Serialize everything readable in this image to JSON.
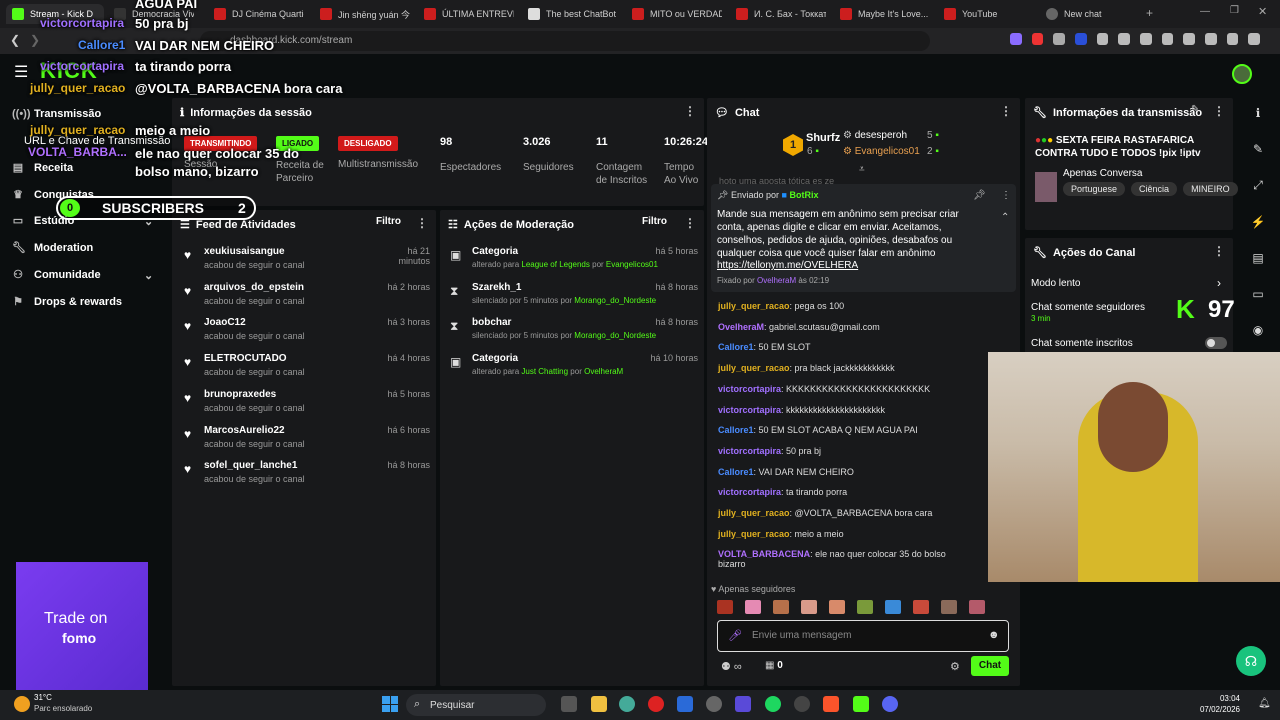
{
  "browser": {
    "tabs": [
      {
        "label": "Stream - Kick D",
        "active": true
      },
      {
        "label": "Democracia Viva"
      },
      {
        "label": "DJ Cinéma Quartier"
      },
      {
        "label": "Jin shēng yuán 今生"
      },
      {
        "label": "ÚLTIMA ENTREVIST"
      },
      {
        "label": "The best ChatBot ar"
      },
      {
        "label": "MITO ou VERDADE"
      },
      {
        "label": "И. С. Бах - Токката"
      },
      {
        "label": "Maybe It's Love..."
      },
      {
        "label": "YouTube"
      },
      {
        "label": "New chat"
      }
    ],
    "url": "dashboard.kick.com/stream"
  },
  "overlay": {
    "lines": [
      {
        "user": "victorcortapira",
        "user_color": "#a070ff",
        "msg": "50 pra bj"
      },
      {
        "user": "Callore1",
        "user_color": "#4a8cff",
        "msg": "VAI DAR NEM CHEIRO"
      },
      {
        "user": "victorcortapira",
        "user_color": "#a070ff",
        "msg": "ta tirando porra"
      },
      {
        "user": "jully_quer_racao",
        "user_color": "#e0b020",
        "msg": "@VOLTA_BARBACENA bora cara"
      },
      {
        "user": "jully_quer_racao",
        "user_color": "#e0b020",
        "msg": "meio a meio"
      },
      {
        "user": "VOLTA_BARBA...",
        "user_color": "#b070ff",
        "msg": "ele nao quer colocar 35 do bolso mano, bizarro"
      }
    ],
    "top_text": "AGUA PAI",
    "subscribers_label": "SUBSCRIBERS",
    "subscribers_left": "0",
    "subscribers_right": "2",
    "kick_count": "97",
    "ad_line1": "Trade on",
    "ad_line2": "fomo"
  },
  "sidebar": {
    "brand": "KICK",
    "items": [
      {
        "label": "Transmissão"
      },
      {
        "label": "URL e Chave de Transmissão"
      },
      {
        "label": "Receita"
      },
      {
        "label": "Conquistas"
      },
      {
        "label": "Estúdio"
      },
      {
        "label": "Moderation"
      },
      {
        "label": "Comunidade"
      },
      {
        "label": "Drops & rewards"
      }
    ]
  },
  "session": {
    "title": "Informações da sessão",
    "badges": [
      {
        "text": "TRANSMITINDO",
        "label": "Sessão",
        "color": "#d11a1a"
      },
      {
        "text": "LIGADO",
        "label": "Receita de Parceiro",
        "color": "#53fc18"
      },
      {
        "text": "DESLIGADO",
        "label": "Multistransmissão",
        "color": "#d11a1a"
      }
    ],
    "stats": [
      {
        "value": "98",
        "label": "Espectadores"
      },
      {
        "value": "3.026",
        "label": "Seguidores"
      },
      {
        "value": "11",
        "label": "Contagem de Inscritos"
      },
      {
        "value": "10:26:24",
        "label": "Tempo Ao Vivo"
      }
    ]
  },
  "activity": {
    "title": "Feed de Atividades",
    "filter": "Filtro",
    "items": [
      {
        "name": "xeukiusaisangue",
        "sub": "acabou de seguir o canal",
        "time": "há 21 minutos"
      },
      {
        "name": "arquivos_do_epstein",
        "sub": "acabou de seguir o canal",
        "time": "há 2 horas"
      },
      {
        "name": "JoaoC12",
        "sub": "acabou de seguir o canal",
        "time": "há 3 horas"
      },
      {
        "name": "ELETROCUTADO",
        "sub": "acabou de seguir o canal",
        "time": "há 4 horas"
      },
      {
        "name": "brunopraxedes",
        "sub": "acabou de seguir o canal",
        "time": "há 5 horas"
      },
      {
        "name": "MarcosAurelio22",
        "sub": "acabou de seguir o canal",
        "time": "há 6 horas"
      },
      {
        "name": "sofel_quer_lanche1",
        "sub": "acabou de seguir o canal",
        "time": "há 8 horas"
      }
    ]
  },
  "moderation": {
    "title": "Ações de Moderação",
    "filter": "Filtro",
    "items": [
      {
        "icon": "category-icon",
        "name": "Categoria",
        "pre": "alterado para ",
        "target": "League of Legends",
        "by": " por ",
        "mod": "Evangelicos01",
        "time": "há 5 horas"
      },
      {
        "icon": "hourglass-icon",
        "name": "Szarekh_1",
        "pre": "silenciado por 5 minutos por ",
        "target": "",
        "by": "",
        "mod": "Morango_do_Nordeste",
        "time": "há 8 horas"
      },
      {
        "icon": "hourglass-icon",
        "name": "bobchar",
        "pre": "silenciado por 5 minutos por ",
        "target": "",
        "by": "",
        "mod": "Morango_do_Nordeste",
        "time": "há 8 horas"
      },
      {
        "icon": "category-icon",
        "name": "Categoria",
        "pre": "alterado para ",
        "target": "Just Chatting",
        "by": " por ",
        "mod": "OvelheraM",
        "time": "há 10 horas"
      }
    ]
  },
  "chat": {
    "title": "Chat",
    "leader": {
      "name": "Shurfz",
      "count": "6",
      "rank": "1"
    },
    "leaders_right": [
      {
        "name": "desesperoh",
        "count": "5"
      },
      {
        "name": "Evangelicos01",
        "count": "2"
      }
    ],
    "hidden_line": "hoto uma aposta tótica es ze",
    "pinned": {
      "sent_by": "Enviado por",
      "bot": "BotRix",
      "text": "Mande sua mensagem em anônimo sem precisar criar conta, apenas digite e clicar em enviar. Aceitamos, conselhos, pedidos de ajuda, opiniões, desabafos ou qualquer coisa que você quiser falar em anônimo",
      "link": "https://tellonym.me/OVELHERA",
      "pinned_label": "Fixado por",
      "pinned_by": "OvelheraM",
      "pinned_time": "às 02:19"
    },
    "messages": [
      {
        "user": "jully_quer_racao",
        "color": "#e0b020",
        "text": ": pega os 100"
      },
      {
        "user": "OvelheraM",
        "color": "#b070ff",
        "text": ": gabriel.scutasu@gmail.com"
      },
      {
        "user": "Callore1",
        "color": "#4a8cff",
        "text": ": 50 EM SLOT"
      },
      {
        "user": "jully_quer_racao",
        "color": "#e0b020",
        "text": ": pra black jackkkkkkkkkkk"
      },
      {
        "user": "victorcortapira",
        "color": "#a070ff",
        "text": ": KKKKKKKKKKKKKKKKKKKKKKKK"
      },
      {
        "user": "victorcortapira",
        "color": "#a070ff",
        "text": ": kkkkkkkkkkkkkkkkkkkkkk"
      },
      {
        "user": "Callore1",
        "color": "#4a8cff",
        "text": ": 50 EM SLOT ACABA Q NEM AGUA PAI"
      },
      {
        "user": "victorcortapira",
        "color": "#a070ff",
        "text": ": 50 pra bj"
      },
      {
        "user": "Callore1",
        "color": "#4a8cff",
        "text": ": VAI DAR NEM CHEIRO"
      },
      {
        "user": "victorcortapira",
        "color": "#a070ff",
        "text": ": ta tirando porra"
      },
      {
        "user": "jully_quer_racao",
        "color": "#e0b020",
        "text": ": @VOLTA_BARBACENA bora cara"
      },
      {
        "user": "jully_quer_racao",
        "color": "#e0b020",
        "text": ": meio a meio"
      },
      {
        "user": "VOLTA_BARBACENA",
        "color": "#b070ff",
        "text": ": ele nao quer colocar 35 do bolso",
        "cont": "bizarro"
      }
    ],
    "followers_only": "Apenas seguidores",
    "input_placeholder": "Envie uma mensagem",
    "points_count": "0",
    "send_label": "Chat"
  },
  "stream_info": {
    "title": "Informações da transmissão",
    "stream_title": "SEXTA FEIRA RASTAFARICA CONTRA TUDO E TODOS !pix !iptv",
    "category": "Apenas Conversa",
    "tags": [
      "Portuguese",
      "Ciência",
      "MINEIRO"
    ]
  },
  "channel_actions": {
    "title": "Ações do Canal",
    "slow_mode": "Modo lento",
    "followers_only": "Chat somente seguidores",
    "followers_min": "3 min",
    "subs_only": "Chat somente inscritos"
  },
  "taskbar": {
    "weather_temp": "31°C",
    "weather_desc": "Parc ensolarado",
    "search": "Pesquisar",
    "time": "03:04",
    "date": "07/02/2026"
  },
  "colors": {
    "kick_green": "#53fc18",
    "live_red": "#d11a1a"
  }
}
